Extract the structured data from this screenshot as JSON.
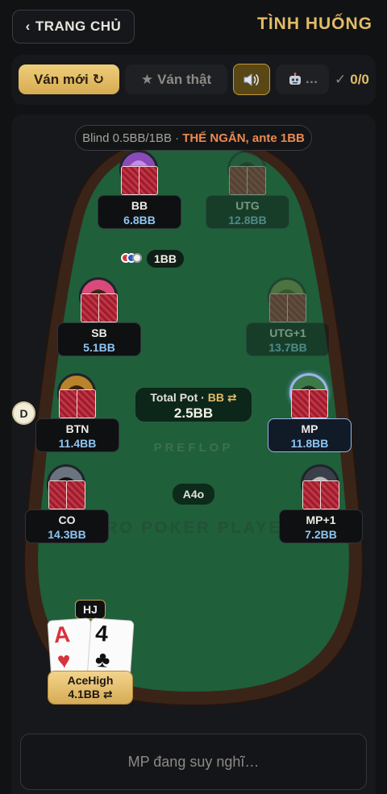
{
  "header": {
    "home_label": "TRANG CHỦ",
    "title": "TÌNH HUỐNG"
  },
  "toolbar": {
    "new_hand_label": "Ván mới",
    "real_hand_label": "Ván thật",
    "bot_label": "…",
    "score": "0/0"
  },
  "table": {
    "blind_text": "Blind 0.5BB/1BB ·",
    "blind_highlight": "THẾ NGẮN, ante 1BB",
    "watermark": "PRO POKER PLAYER",
    "street": "PREFLOP",
    "pot_label": "Total Pot ·",
    "pot_unit": "BB",
    "pot_value": "2.5BB",
    "bet_value": "1BB",
    "dealer_label": "D",
    "hand_label": "A4o"
  },
  "seats": {
    "bb": {
      "name": "BB",
      "stack": "6.8BB"
    },
    "utg": {
      "name": "UTG",
      "stack": "12.8BB"
    },
    "sb": {
      "name": "SB",
      "stack": "5.1BB"
    },
    "utg1": {
      "name": "UTG+1",
      "stack": "13.7BB"
    },
    "btn": {
      "name": "BTN",
      "stack": "11.4BB"
    },
    "mp": {
      "name": "MP",
      "stack": "11.8BB"
    },
    "co": {
      "name": "CO",
      "stack": "14.3BB"
    },
    "mp1": {
      "name": "MP+1",
      "stack": "7.2BB"
    }
  },
  "hero": {
    "position": "HJ",
    "card1_rank": "A",
    "card1_suit": "♥",
    "card2_rank": "4",
    "card2_suit": "♣",
    "name": "AceHigh",
    "stack": "4.1BB"
  },
  "status": {
    "message": "MP đang suy nghĩ…"
  },
  "colors": {
    "accent_gold": "#e3bc66",
    "felt": "#1f5f3a",
    "rail": "#3a2418",
    "stack_blue": "#8ec6f2",
    "warning_orange": "#ea8a52"
  }
}
